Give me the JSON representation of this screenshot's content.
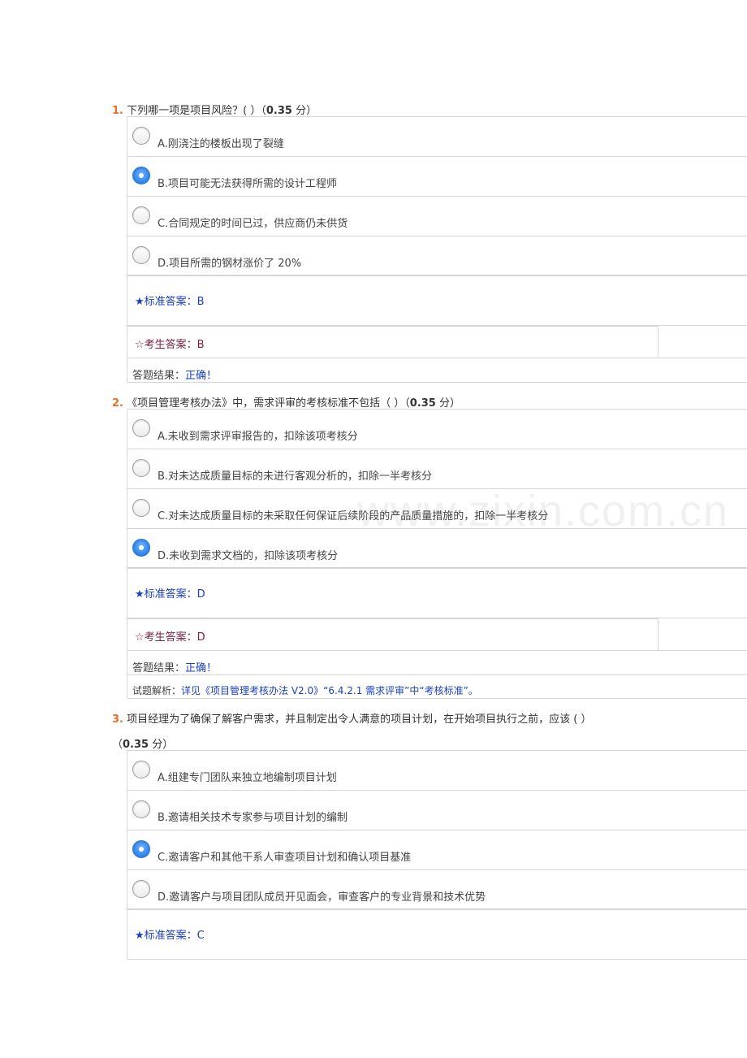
{
  "watermark": "www.zixin.com.cn",
  "questions": [
    {
      "number": "1.",
      "text": "下列哪一项是项目风险？( ）",
      "score_open": "（",
      "score_value": "0.35",
      "score_unit": " 分）",
      "options": [
        {
          "label": "A.刚浇注的楼板出现了裂缝",
          "selected": false
        },
        {
          "label": "B.项目可能无法获得所需的设计工程师",
          "selected": true
        },
        {
          "label": "C.合同规定的时间已过，供应商仍未供货",
          "selected": false
        },
        {
          "label": "D.项目所需的钢材涨价了 20%",
          "selected": false
        }
      ],
      "standard_answer": "★标准答案：B",
      "student_answer": "☆考生答案：B",
      "result_label": "答题结果：",
      "result_value": "正确！"
    },
    {
      "number": "2.",
      "text": "《项目管理考核办法》中，需求评审的考核标准不包括（ ）",
      "score_open": "（",
      "score_value": "0.35",
      "score_unit": " 分）",
      "options": [
        {
          "label": "A.未收到需求评审报告的，扣除该项考核分",
          "selected": false
        },
        {
          "label": "B.对未达成质量目标的未进行客观分析的，扣除一半考核分",
          "selected": false
        },
        {
          "label": "C.对未达成质量目标的未采取任何保证后续阶段的产品质量措施的，扣除一半考核分",
          "selected": false
        },
        {
          "label": "D.未收到需求文档的，扣除该项考核分",
          "selected": true
        }
      ],
      "standard_answer": "★标准答案：D",
      "student_answer": "☆考生答案：D",
      "result_label": "答题结果：",
      "result_value": "正确！",
      "analysis_label": "试题解析：",
      "analysis_value": "详见《项目管理考核办法 V2.0》“6.4.2.1 需求评审”中“考核标准”。"
    },
    {
      "number": "3.",
      "text": "项目经理为了确保了解客户需求，并且制定出令人满意的项目计划，在开始项目执行之前，应该 ( ）",
      "score_open": "（",
      "score_value": "0.35",
      "score_unit": " 分）",
      "options": [
        {
          "label": "A.组建专门团队来独立地编制项目计划",
          "selected": false
        },
        {
          "label": "B.邀请相关技术专家参与项目计划的编制",
          "selected": false
        },
        {
          "label": "C.邀请客户和其他干系人审查项目计划和确认项目基准",
          "selected": true
        },
        {
          "label": "D.邀请客户与项目团队成员开见面会，审查客户的专业背景和技术优势",
          "selected": false
        }
      ],
      "standard_answer": "★标准答案：C"
    }
  ]
}
